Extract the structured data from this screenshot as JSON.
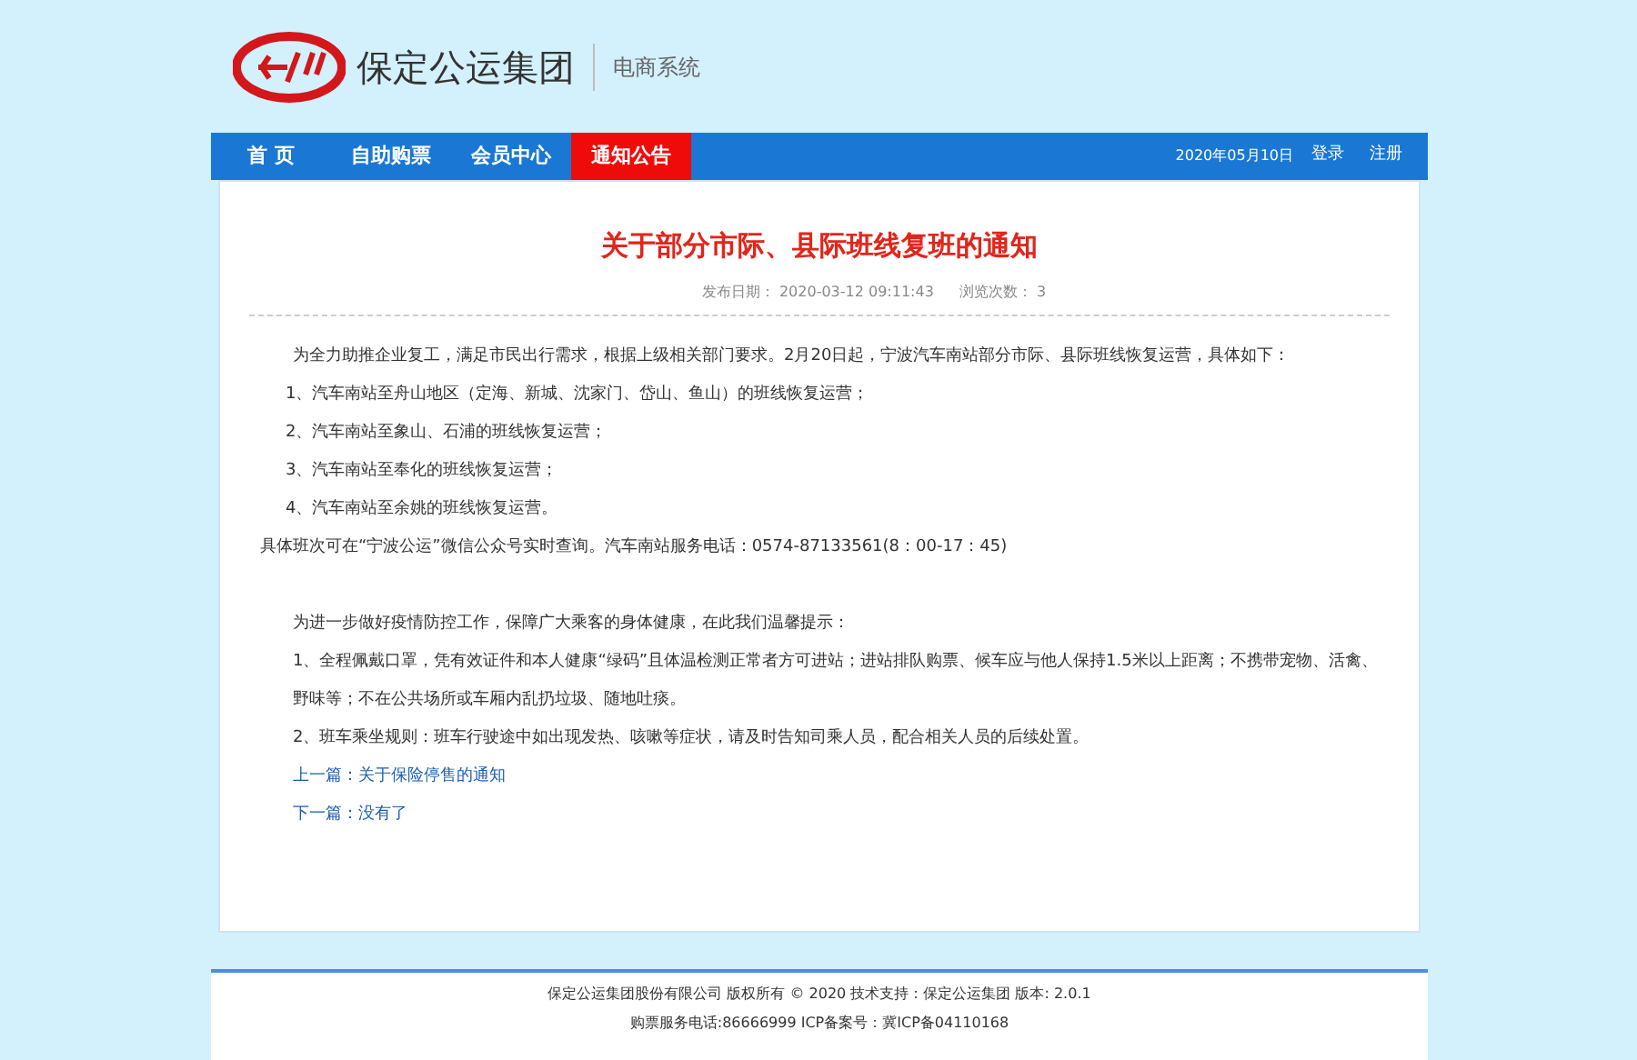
{
  "header": {
    "brand": "保定公运集团",
    "subtitle": "电商系统"
  },
  "nav": {
    "items": [
      {
        "label": "首 页",
        "selected": false
      },
      {
        "label": "自助购票",
        "selected": false
      },
      {
        "label": "会员中心",
        "selected": false
      },
      {
        "label": "通知公告",
        "selected": true
      }
    ],
    "date": "2020年05月10日",
    "links": [
      "登录",
      "注册"
    ]
  },
  "article": {
    "title": "关于部分市际、县际班线复班的通知",
    "meta": [
      {
        "label": "发布日期：",
        "value": "2020-03-12 09:11:43"
      },
      {
        "label": "浏览次数：",
        "value": "3"
      }
    ],
    "sections": [
      {
        "paragraphs": [
          {
            "text": "为全力助推企业复工，满足市民出行需求，根据上级相关部门要求。2月20日起，宁波汽车南站部分市际、县际班线恢复运营，具体如下：",
            "kind": "lead"
          },
          {
            "text": "1、汽车南站至舟山地区（定海、新城、沈家门、岱山、鱼山）的班线恢复运营；",
            "kind": "item"
          },
          {
            "text": "2、汽车南站至象山、石浦的班线恢复运营；",
            "kind": "item"
          },
          {
            "text": "3、汽车南站至奉化的班线恢复运营；",
            "kind": "item"
          },
          {
            "text": "4、汽车南站至余姚的班线恢复运营。",
            "kind": "item"
          },
          {
            "text": "具体班次可在“宁波公运”微信公众号实时查询。汽车南站服务电话：0574-87133561(8：00-17：45)",
            "kind": "plain"
          }
        ]
      },
      {
        "paragraphs": [
          {
            "text": "为进一步做好疫情防控工作，保障广大乘客的身体健康，在此我们温馨提示：",
            "kind": "lead"
          },
          {
            "text": "1、全程佩戴口罩，凭有效证件和本人健康“绿码”且体温检测正常者方可进站；进站排队购票、候车应与他人保持1.5米以上距离；不携带宠物、活禽、野味等；不在公共场所或车厢内乱扔垃圾、随地吐痰。",
            "kind": "lead"
          },
          {
            "text": "2、班车乘坐规则：班车行驶途中如出现发热、咳嗽等症状，请及时告知司乘人员，配合相关人员的后续处置。",
            "kind": "lead"
          }
        ]
      }
    ],
    "links": [
      {
        "label": "上一篇：",
        "value": "关于保险停售的通知"
      },
      {
        "label": "下一篇：",
        "value": "没有了"
      }
    ]
  },
  "footer": [
    "保定公运集团股份有限公司 版权所有 © 2020 技术支持：保定公运集团 版本: 2.0.1",
    "购票服务电话:86666999 ICP备案号：冀ICP备04110168"
  ]
}
